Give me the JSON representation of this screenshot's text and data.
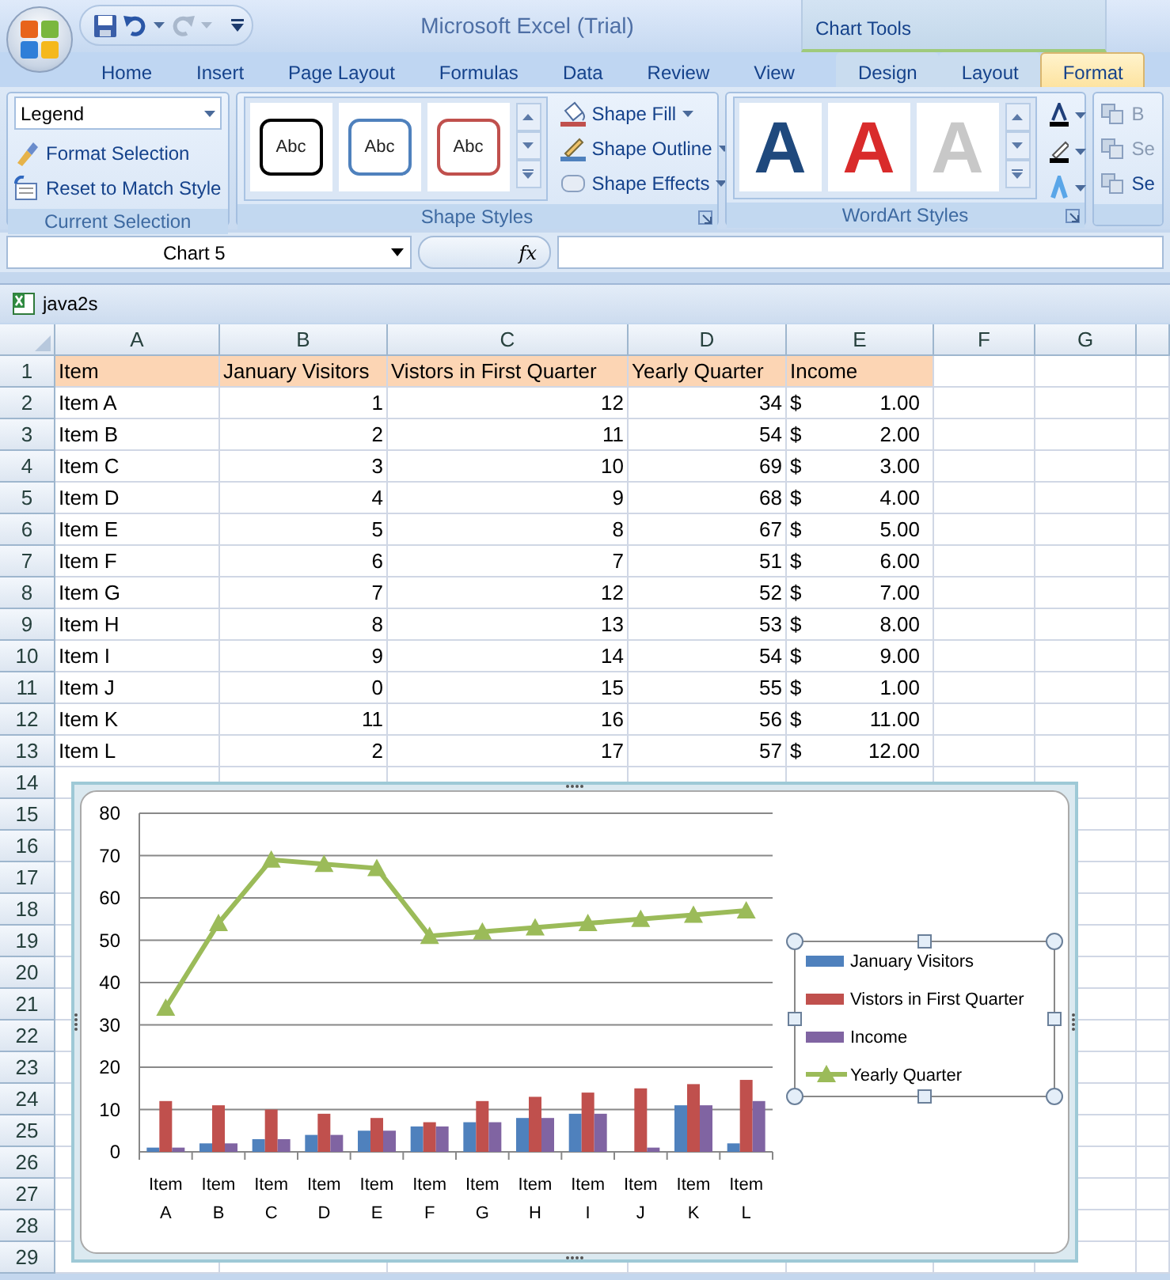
{
  "title_bar": {
    "title": "Microsoft Excel (Trial)"
  },
  "tabs": [
    {
      "label": "Home",
      "selected": false
    },
    {
      "label": "Insert",
      "selected": false
    },
    {
      "label": "Page Layout",
      "selected": false
    },
    {
      "label": "Formulas",
      "selected": false
    },
    {
      "label": "Data",
      "selected": false
    },
    {
      "label": "Review",
      "selected": false
    },
    {
      "label": "View",
      "selected": false
    }
  ],
  "chart_tools": {
    "label": "Chart Tools",
    "tabs": [
      {
        "label": "Design",
        "selected": false
      },
      {
        "label": "Layout",
        "selected": false
      },
      {
        "label": "Format",
        "selected": true
      }
    ]
  },
  "current_selection": {
    "element": "Legend",
    "commands": [
      "Format Selection",
      "Reset to Match Style"
    ],
    "label": "Current Selection"
  },
  "shape_styles": {
    "samples": [
      {
        "text": "Abc",
        "color": "#000000"
      },
      {
        "text": "Abc",
        "color": "#4f81bd"
      },
      {
        "text": "Abc",
        "color": "#c0504d"
      }
    ],
    "commands": [
      "Shape Fill",
      "Shape Outline",
      "Shape Effects"
    ],
    "label": "Shape Styles"
  },
  "wordart_styles": {
    "samples": [
      {
        "text": "A",
        "color": "#1f497d"
      },
      {
        "text": "A",
        "color": "#d92b2b"
      },
      {
        "text": "A",
        "color": "#c8c8c8"
      }
    ],
    "label": "WordArt Styles"
  },
  "arrange": {
    "commands": [
      {
        "label": "B",
        "disabled": true
      },
      {
        "label": "Se",
        "disabled": true
      },
      {
        "label": "Se",
        "disabled": false
      }
    ]
  },
  "formula_bar": {
    "name_box": "Chart 5",
    "function_label": "fx"
  },
  "workbook": {
    "title": "java2s",
    "columns": [
      "A",
      "B",
      "C",
      "D",
      "E",
      "F",
      "G"
    ],
    "row_headers": [
      "1",
      "2",
      "3",
      "4",
      "5",
      "6",
      "7",
      "8",
      "9",
      "10",
      "11",
      "12",
      "13",
      "14",
      "15",
      "16",
      "17",
      "18",
      "19",
      "20",
      "21",
      "22",
      "23",
      "24",
      "25",
      "26",
      "27",
      "28",
      "29"
    ],
    "header": [
      "Item",
      "January Visitors",
      "Vistors in First Quarter",
      "Yearly Quarter",
      "Income"
    ],
    "rows": [
      {
        "cells": [
          "Item A",
          "1",
          "12",
          "34"
        ],
        "currency": "$",
        "income": "1.00"
      },
      {
        "cells": [
          "Item B",
          "2",
          "11",
          "54"
        ],
        "currency": "$",
        "income": "2.00"
      },
      {
        "cells": [
          "Item C",
          "3",
          "10",
          "69"
        ],
        "currency": "$",
        "income": "3.00"
      },
      {
        "cells": [
          "Item D",
          "4",
          "9",
          "68"
        ],
        "currency": "$",
        "income": "4.00"
      },
      {
        "cells": [
          "Item E",
          "5",
          "8",
          "67"
        ],
        "currency": "$",
        "income": "5.00"
      },
      {
        "cells": [
          "Item F",
          "6",
          "7",
          "51"
        ],
        "currency": "$",
        "income": "6.00"
      },
      {
        "cells": [
          "Item G",
          "7",
          "12",
          "52"
        ],
        "currency": "$",
        "income": "7.00"
      },
      {
        "cells": [
          "Item H",
          "8",
          "13",
          "53"
        ],
        "currency": "$",
        "income": "8.00"
      },
      {
        "cells": [
          "Item I",
          "9",
          "14",
          "54"
        ],
        "currency": "$",
        "income": "9.00"
      },
      {
        "cells": [
          "Item J",
          "0",
          "15",
          "55"
        ],
        "currency": "$",
        "income": "1.00"
      },
      {
        "cells": [
          "Item K",
          "11",
          "16",
          "56"
        ],
        "currency": "$",
        "income": "11.00"
      },
      {
        "cells": [
          "Item L",
          "2",
          "17",
          "57"
        ],
        "currency": "$",
        "income": "12.00"
      }
    ]
  },
  "chart": {
    "chart_data": {
      "type": "bar",
      "categories": [
        "Item A",
        "Item B",
        "Item C",
        "Item D",
        "Item E",
        "Item F",
        "Item G",
        "Item H",
        "Item I",
        "Item J",
        "Item K",
        "Item L"
      ],
      "series": [
        {
          "name": "January Visitors",
          "color": "#4f81bd",
          "values": [
            1,
            2,
            3,
            4,
            5,
            6,
            7,
            8,
            9,
            0,
            11,
            2
          ]
        },
        {
          "name": "Vistors in First Quarter",
          "color": "#c0504d",
          "values": [
            12,
            11,
            10,
            9,
            8,
            7,
            12,
            13,
            14,
            15,
            16,
            17
          ]
        },
        {
          "name": "Income",
          "color": "#8064a2",
          "values": [
            1,
            2,
            3,
            4,
            5,
            6,
            7,
            8,
            9,
            1,
            11,
            12
          ]
        },
        {
          "name": "Yearly Quarter",
          "color": "#9bbb59",
          "type": "line",
          "marker": "triangle",
          "values": [
            34,
            54,
            69,
            68,
            67,
            51,
            52,
            53,
            54,
            55,
            56,
            57
          ]
        }
      ],
      "grid": true,
      "legend": "right",
      "ylim": [
        0,
        80
      ],
      "yticks": [
        0,
        10,
        20,
        30,
        40,
        50,
        60,
        70,
        80
      ]
    }
  }
}
